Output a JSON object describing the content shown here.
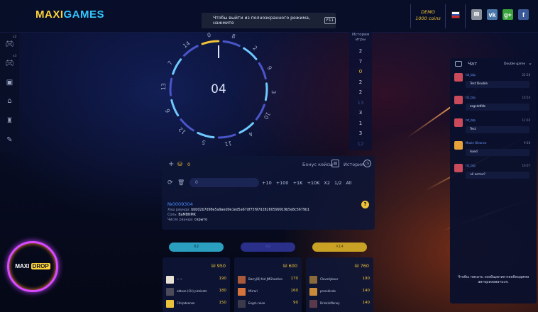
{
  "header": {
    "logo_part1": "MAXI",
    "logo_part2": "GAMES",
    "fullscreen_tip": "Чтобы выйти из полноэкранного режима, нажмите",
    "fullscreen_key": "F11",
    "demo_label": "DEMO",
    "demo_coins": "1000 coins",
    "social": [
      {
        "name": "mail-icon",
        "glyph": "✉",
        "color": "#8a8f9c"
      },
      {
        "name": "vk-icon",
        "glyph": "vk",
        "color": "#4a76a8"
      },
      {
        "name": "google-plus-icon",
        "glyph": "g+",
        "color": "#3aa23a"
      },
      {
        "name": "facebook-icon",
        "glyph": "f",
        "color": "#3b5998"
      }
    ]
  },
  "sidebar": {
    "badges": [
      "x2",
      "x3"
    ]
  },
  "wheel": {
    "timer": "04",
    "numbers": [
      "0",
      "8",
      "2",
      "9",
      "3",
      "10",
      "4",
      "11",
      "5",
      "12",
      "6",
      "13",
      "7",
      "14"
    ]
  },
  "history": {
    "title_line1": "История",
    "title_line2": "игры",
    "items": [
      {
        "value": "2",
        "color": "#c9d4ea"
      },
      {
        "value": "7",
        "color": "#c9d4ea"
      },
      {
        "value": "0",
        "color": "#f0c236"
      },
      {
        "value": "2",
        "color": "#c9d4ea"
      },
      {
        "value": "2",
        "color": "#c9d4ea"
      },
      {
        "value": "13",
        "color": "#34497e"
      },
      {
        "value": "3",
        "color": "#c9d4ea"
      },
      {
        "value": "1",
        "color": "#c9d4ea"
      },
      {
        "value": "3",
        "color": "#c9d4ea"
      },
      {
        "value": "12",
        "color": "#34497e"
      }
    ]
  },
  "bet_panel": {
    "balance": "0",
    "bonus_cases": "Бонус кейсы",
    "history_link": "История",
    "bet_input_placeholder": "0",
    "quick_bets": [
      "+10",
      "+100",
      "+1K",
      "+10K",
      "X2",
      "1/2",
      "All"
    ],
    "round_number": "№0009304",
    "hash_label": "Хэш раунда:",
    "hash_value": "bbb02b7d98e5a9aed0e1ed5a67df75f97d28260599919b5e8c5679b1",
    "salt_label": "Соль:",
    "salt_value": "BaMBNMK",
    "round_number_label": "Число раунда:",
    "round_number_value": "скрыто"
  },
  "color_buttons": [
    {
      "label": "X2",
      "bg": "#2a9fc0",
      "fg": "#0e2a48"
    },
    {
      "label": "X2",
      "bg": "#2a2f8a",
      "fg": "#4a54b8"
    },
    {
      "label": "X14",
      "bg": "#c9a225",
      "fg": "#5a4510"
    }
  ],
  "bet_columns": [
    {
      "total": "950",
      "bets": [
        {
          "name": "~ ~",
          "amount": "190",
          "avatar": "#e8e2d4"
        },
        {
          "name": "obtuse (CH) pizzicatz",
          "amount": "180",
          "avatar": "#4a4a5a"
        },
        {
          "name": "Chirpdeanon",
          "amount": "150",
          "avatar": "#e8c23a"
        }
      ]
    },
    {
      "total": "600",
      "bets": [
        {
          "name": "Barry(B) fed JMGhostion",
          "amount": "170",
          "avatar": "#a85a3a"
        },
        {
          "name": "Mirrari",
          "amount": "160",
          "avatar": "#d4743a"
        },
        {
          "name": "EngcL.roiee",
          "amount": "90",
          "avatar": "#3a3a4a"
        }
      ]
    },
    {
      "total": "760",
      "bets": [
        {
          "name": "Clovedybour",
          "amount": "190",
          "avatar": "#8a6a3a"
        },
        {
          "name": "pressdinde",
          "amount": "140",
          "avatar": "#c98a3a"
        },
        {
          "name": "DrinkinMoney",
          "amount": "140",
          "avatar": "#5a3a4a"
        }
      ]
    }
  ],
  "chat": {
    "title": "Чат",
    "room": "Double game",
    "messages": [
      {
        "name": "tst_btp",
        "time": "22:58",
        "text": "Test Double",
        "avatar": "#c94a5a"
      },
      {
        "name": "tst_btp",
        "time": "10:54",
        "text": "zsgcddfdb",
        "avatar": "#c94a5a"
      },
      {
        "name": "tst_btp",
        "time": "11:26",
        "text": "Test",
        "avatar": "#c94a5a"
      },
      {
        "name": "Maxie Oleonce",
        "time": "9:58",
        "text": "Axed",
        "avatar": "#e8a23a"
      },
      {
        "name": "tst_btp",
        "time": "10:07",
        "text": "чё хотел?",
        "avatar": "#c94a5a"
      }
    ],
    "login_note": "Чтобы писать сообщения необходимо авторизоваться."
  },
  "promo": {
    "logo_part1": "MAXI",
    "logo_part2": "DROP"
  }
}
